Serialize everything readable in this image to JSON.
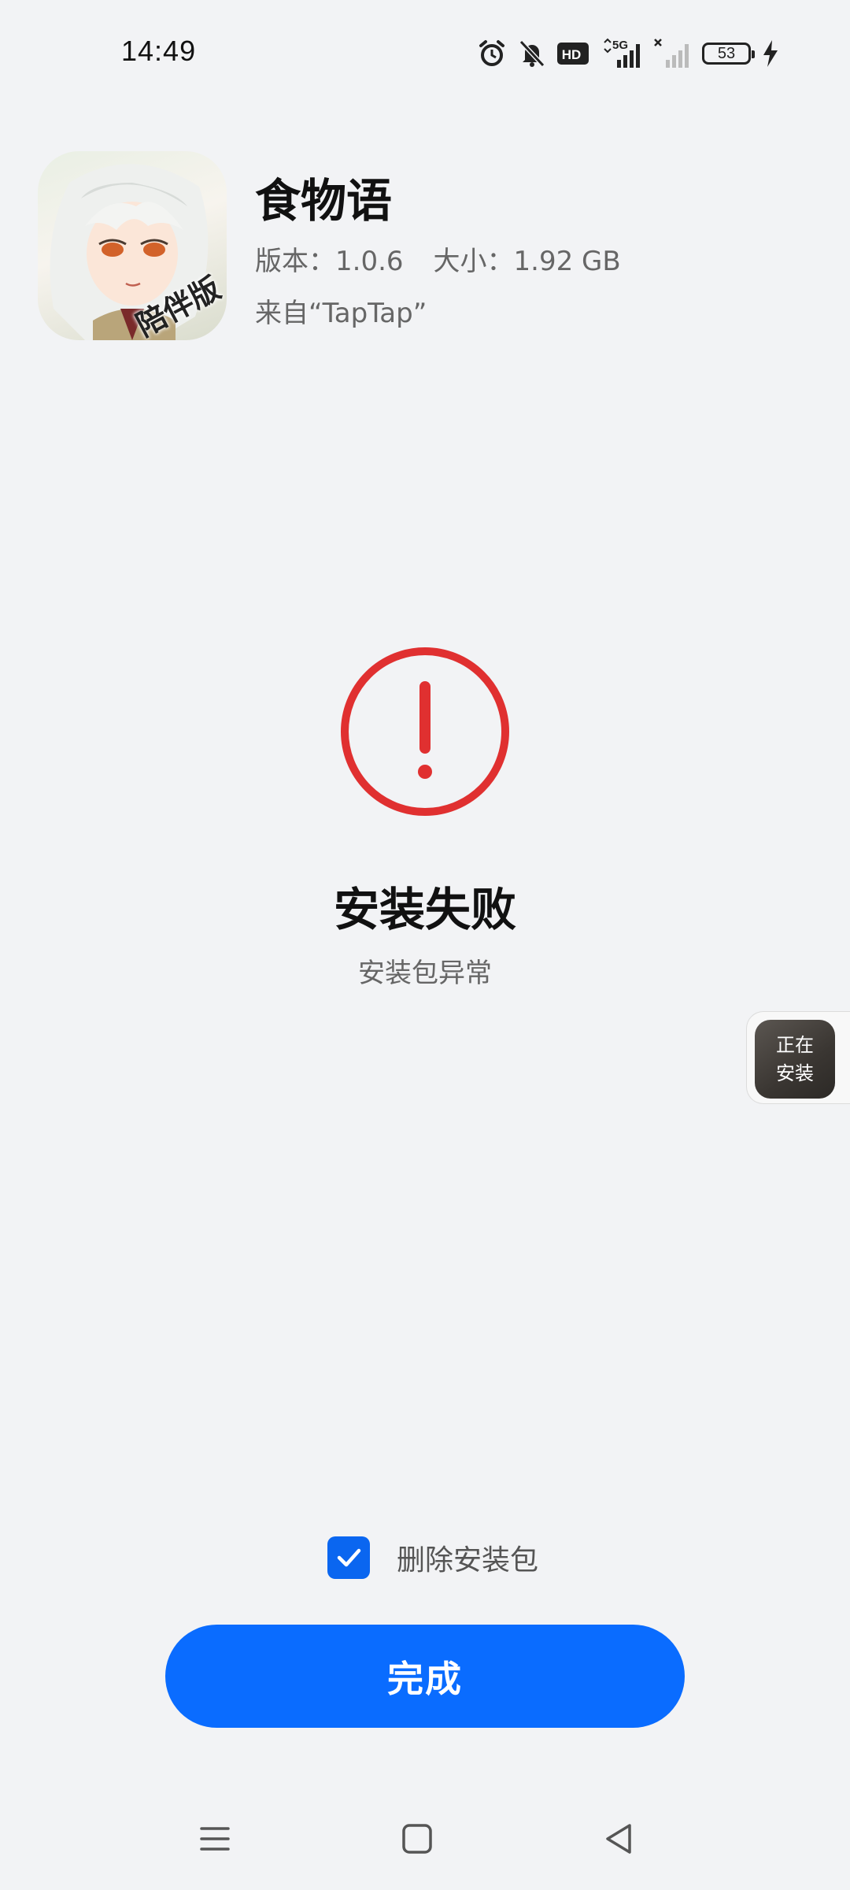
{
  "status_bar": {
    "time": "14:49",
    "battery_level": "53",
    "icons": [
      "alarm-icon",
      "mute-bell-icon",
      "hd-icon",
      "5g-signal-icon",
      "no-signal-icon",
      "battery-icon",
      "charging-icon"
    ],
    "hd_label": "HD",
    "network_label": "5G"
  },
  "app": {
    "name": "食物语",
    "version": "版本：1.0.6",
    "size": "大小：1.92 GB",
    "source": "来自“TapTap”",
    "icon_badge": "陪伴版"
  },
  "result": {
    "title": "安装失败",
    "subtitle": "安装包异常",
    "status_color": "#e03030"
  },
  "floating_widget": {
    "line1": "正在",
    "line2": "安装"
  },
  "options": {
    "delete_package_label": "删除安装包",
    "delete_package_checked": true
  },
  "actions": {
    "done_label": "完成",
    "accent_color": "#0a6cff"
  },
  "nav_bar": {
    "buttons": [
      "menu-icon",
      "home-icon",
      "back-icon"
    ]
  }
}
